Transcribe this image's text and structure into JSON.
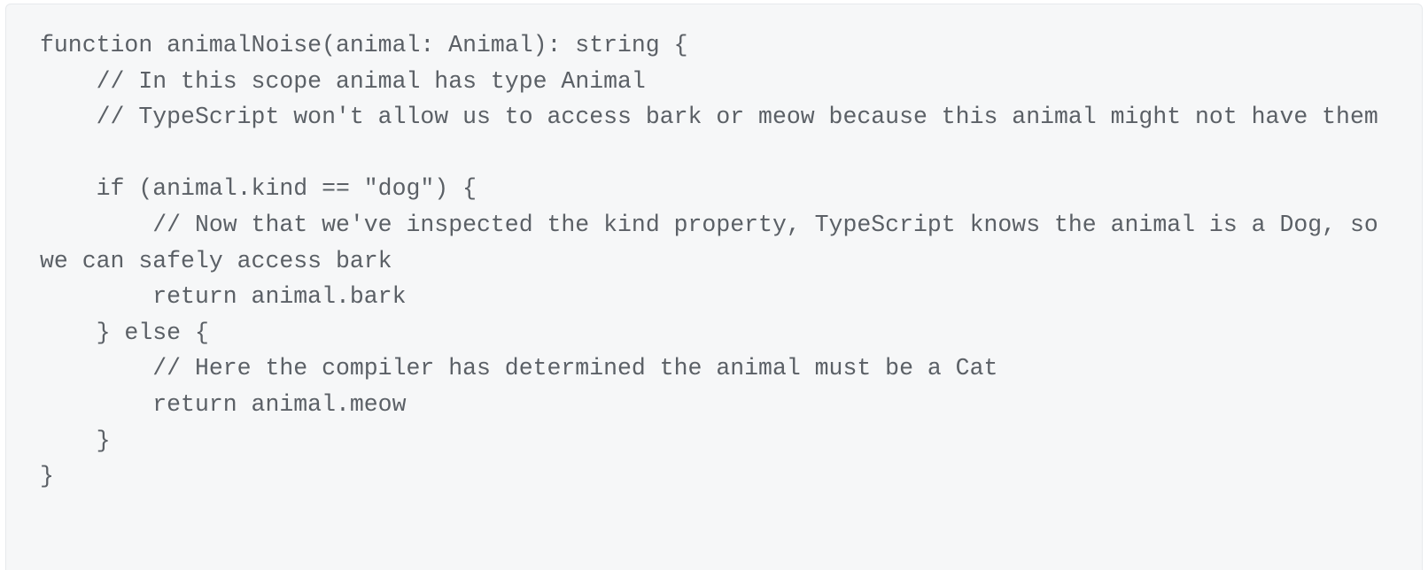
{
  "code_block": {
    "language": "typescript",
    "background_color": "#f6f7f8",
    "border_color": "#e7e9ec",
    "text_color": "#5b6066",
    "lines": [
      "function animalNoise(animal: Animal): string {",
      "    // In this scope animal has type Animal",
      "    // TypeScript won't allow us to access bark or meow because this animal might not have them",
      "",
      "    if (animal.kind == \"dog\") {",
      "        // Now that we've inspected the kind property, TypeScript knows the animal is a Dog, so we can safely access bark",
      "        return animal.bark",
      "    } else {",
      "        // Here the compiler has determined the animal must be a Cat",
      "        return animal.meow",
      "    }",
      "}"
    ],
    "code": "function animalNoise(animal: Animal): string {\n    // In this scope animal has type Animal\n    // TypeScript won't allow us to access bark or meow because this animal might not have them\n\n    if (animal.kind == \"dog\") {\n        // Now that we've inspected the kind property, TypeScript knows the animal is a Dog, so we can safely access bark\n        return animal.bark\n    } else {\n        // Here the compiler has determined the animal must be a Cat\n        return animal.meow\n    }\n}"
  }
}
